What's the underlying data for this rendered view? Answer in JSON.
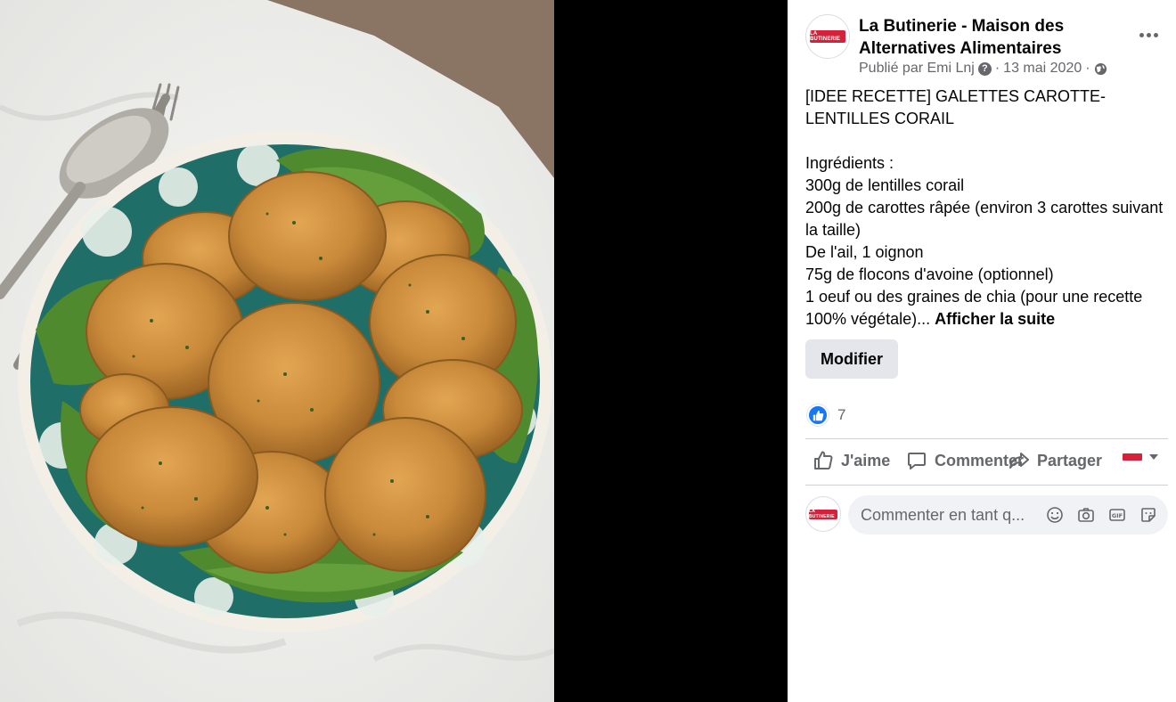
{
  "post": {
    "page_name": "La Butinerie - Maison des Alternatives Alimentaires",
    "avatar_logo_text": "LA BUTINERIE",
    "published_by": "Publié par Emi Lnj",
    "help_glyph": "?",
    "separator": "·",
    "date": "13 mai 2020",
    "separator2": "·",
    "privacy_icon": "globe-icon",
    "text_line1": "[IDEE RECETTE] GALETTES CAROTTE-LENTILLES CORAIL",
    "ingredients_title": "Ingrédients :",
    "ingredient_1": "300g de lentilles corail",
    "ingredient_2": "200g de carottes râpée (environ 3 carottes suivant la taille)",
    "ingredient_3": "De l'ail, 1 oignon",
    "ingredient_4": "75g de flocons d'avoine (optionnel)",
    "ingredient_5": "1 oeuf ou des graines de chia (pour une recette 100% végétale)...",
    "see_more": "Afficher la suite",
    "edit_button": "Modifier"
  },
  "reactions": {
    "type": "like",
    "count": "7"
  },
  "actions": {
    "like": "J'aime",
    "comment": "Commenter",
    "share": "Partager"
  },
  "comment_box": {
    "placeholder": "Commenter en tant q..."
  },
  "icons": {
    "more": "more-options-icon",
    "like": "thumbs-up-icon",
    "comment": "comment-bubble-icon",
    "share": "share-arrow-icon",
    "emoji": "emoji-icon",
    "camera": "camera-icon",
    "gif": "gif-icon",
    "sticker": "sticker-icon"
  },
  "colors": {
    "brand_blue": "#1877f2",
    "logo_red": "#d6213a",
    "secondary_text": "#65676b",
    "button_bg": "#e4e6eb"
  }
}
